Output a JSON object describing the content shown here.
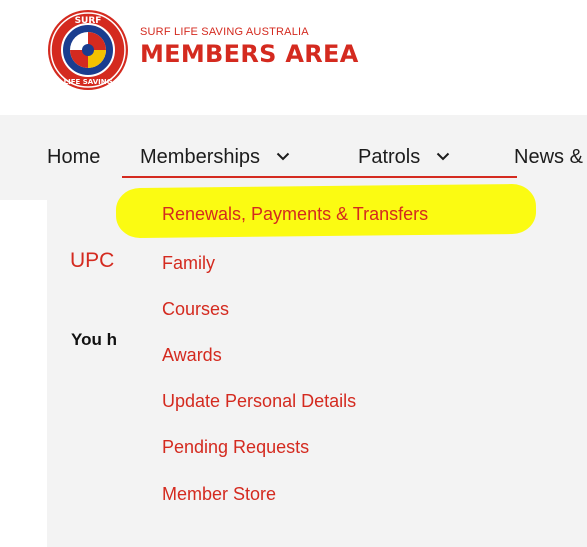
{
  "header": {
    "brand_small": "SURF LIFE SAVING AUSTRALIA",
    "brand_title": "MEMBERS AREA",
    "logo_top_text": "SURF",
    "logo_bottom_text": "LIFE SAVING"
  },
  "nav": {
    "items": [
      {
        "label": "Home",
        "has_dropdown": false
      },
      {
        "label": "Memberships",
        "has_dropdown": true
      },
      {
        "label": "Patrols",
        "has_dropdown": true
      },
      {
        "label": "News &",
        "has_dropdown": false
      }
    ]
  },
  "dropdown": {
    "items": [
      "Renewals, Payments & Transfers",
      "Family",
      "Courses",
      "Awards",
      "Update Personal Details",
      "Pending Requests",
      "Member Store"
    ]
  },
  "content": {
    "heading_partial": "UPC",
    "text_partial": "You h"
  },
  "colors": {
    "accent": "#d42a1f",
    "highlight": "#fbfb12",
    "nav_bg": "#f3f3f3"
  }
}
